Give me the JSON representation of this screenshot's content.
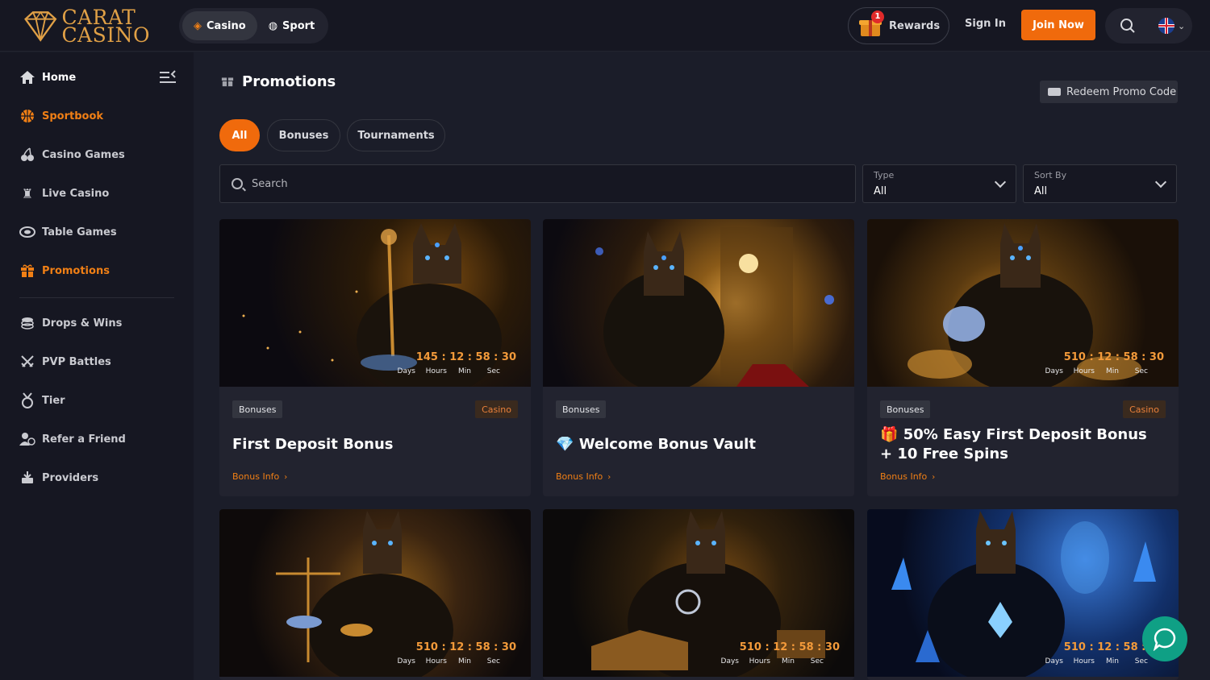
{
  "brand": {
    "line1": "CARAT",
    "line2": "CASINO",
    "color": "#e0a046"
  },
  "top_tabs": [
    {
      "label": "Casino",
      "icon": "casino-icon"
    },
    {
      "label": "Sport",
      "icon": "sport-ball-icon"
    }
  ],
  "header": {
    "rewards_label": "Rewards",
    "rewards_badge": "1",
    "signin_label": "Sign In",
    "join_label": "Join Now"
  },
  "sidebar": {
    "items": [
      {
        "label": "Home",
        "icon": "home-icon"
      },
      {
        "label": "Sportbook",
        "icon": "basketball-icon"
      },
      {
        "label": "Casino Games",
        "icon": "cherries-icon"
      },
      {
        "label": "Live Casino",
        "icon": "chess-piece-icon"
      },
      {
        "label": "Table Games",
        "icon": "chip-icon"
      },
      {
        "label": "Promotions",
        "icon": "gift-icon"
      },
      {
        "label": "Drops & Wins",
        "icon": "coins-icon"
      },
      {
        "label": "PVP Battles",
        "icon": "swords-icon"
      },
      {
        "label": "Tier",
        "icon": "medal-icon"
      },
      {
        "label": "Refer a Friend",
        "icon": "refer-friend-icon"
      },
      {
        "label": "Providers",
        "icon": "providers-icon"
      }
    ]
  },
  "main": {
    "title": "Promotions",
    "redeem_label": "Redeem Promo Code",
    "filters": [
      "All",
      "Bonuses",
      "Tournaments"
    ],
    "search_placeholder": "Search",
    "type_select": {
      "label": "Type",
      "value": "All"
    },
    "sort_select": {
      "label": "Sort By",
      "value": "All"
    }
  },
  "countdown_labels": {
    "days": "Days",
    "hours": "Hours",
    "min": "Min",
    "sec": "Sec"
  },
  "cards": [
    {
      "title": "First Deposit Bonus",
      "emoji": "",
      "tag": "Bonuses",
      "tag2": "Casino",
      "info": "Bonus Info",
      "days": "145",
      "hours": "12",
      "min": "58",
      "sec": "30"
    },
    {
      "title": "Welcome Bonus Vault",
      "emoji": "💎",
      "tag": "Bonuses",
      "tag2": "",
      "info": "Bonus Info",
      "days": "",
      "hours": "",
      "min": "",
      "sec": ""
    },
    {
      "title": "50% Easy First Deposit Bonus + 10 Free Spins",
      "emoji": "🎁",
      "tag": "Bonuses",
      "tag2": "Casino",
      "info": "Bonus Info",
      "days": "510",
      "hours": "12",
      "min": "58",
      "sec": "30"
    },
    {
      "days": "510",
      "hours": "12",
      "min": "58",
      "sec": "30"
    },
    {
      "days": "510",
      "hours": "12",
      "min": "58",
      "sec": "30"
    },
    {
      "days": "510",
      "hours": "12",
      "min": "58",
      "sec": "30"
    }
  ],
  "colors": {
    "accent": "#f06a0c",
    "background": "#1b1d29",
    "sidebar": "#161722",
    "card": "#22232f",
    "chat": "#0fa085"
  }
}
